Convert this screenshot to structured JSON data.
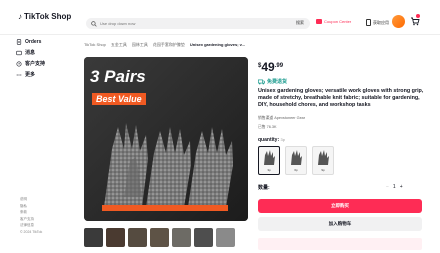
{
  "header": {
    "brand": "TikTok Shop",
    "search_placeholder": "Use drop down now",
    "search_button": "搜索",
    "coupon_label": "Coupon Center",
    "app_label": "获取应用"
  },
  "sidebar": {
    "items": [
      {
        "label": "Orders",
        "icon": "orders-icon"
      },
      {
        "label": "消息",
        "icon": "message-icon"
      },
      {
        "label": "客户支持",
        "icon": "support-icon"
      },
      {
        "label": "更多",
        "icon": "more-icon"
      }
    ],
    "footer_links": [
      "说明",
      "隐私",
      "条款",
      "客户支持",
      "法律信息",
      "© 2024 TikTok"
    ]
  },
  "breadcrumb": [
    "TikTok Shop",
    "五金工具",
    "园林工具",
    "花园手套和护膝垫",
    "Unisex gardening gloves; v..."
  ],
  "product": {
    "banner_line1": "3 Pairs",
    "banner_line2": "Best Value",
    "price_currency": "$",
    "price_whole": "49",
    "price_cents": ".99",
    "shipping_label": "免费退货",
    "title": "Unisex gardening gloves; versatile work gloves with strong grip, made of stretchy, breathable knit fabric; suitable for gardening, DIY, household chores, and workshop tasks",
    "ship_from": "销售渠道  Apexstoneer Gear",
    "sold": "已售 76.3K",
    "quantity_label": "quantity:",
    "quantity_hint": "3p",
    "options": [
      {
        "label": "3p"
      },
      {
        "label": "6p"
      },
      {
        "label": "9p"
      }
    ],
    "number_label": "数量:",
    "qty_value": "1",
    "buy_now": "立即购买",
    "add_to_cart": "加入购物车"
  },
  "colors": {
    "accent": "#fe2c55",
    "ship_teal": "#1a9b8e",
    "banner_orange": "#f05a22"
  }
}
